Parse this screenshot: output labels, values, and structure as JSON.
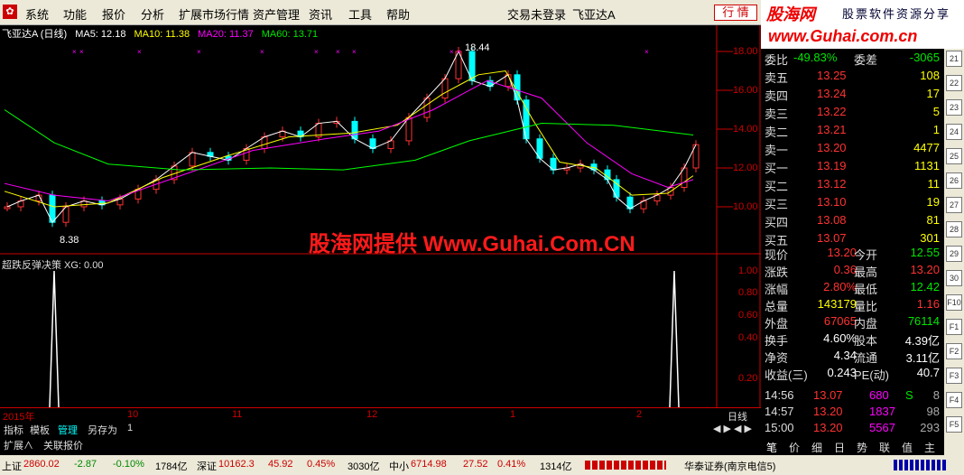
{
  "menu": {
    "items": [
      "系统",
      "功能",
      "报价",
      "分析",
      "扩展市场行情",
      "资产管理",
      "资讯",
      "工具",
      "帮助"
    ],
    "login_status": "交易未登录",
    "stock_title": "飞亚达A",
    "pill_label": "行 情"
  },
  "brand": {
    "name": "股海网",
    "slogan": "股票软件资源分享",
    "url": "www.Guhai.com.cn"
  },
  "legend": {
    "stock": "飞亚达A (日线)",
    "ma5": "MA5: 12.18",
    "ma10": "MA10: 11.38",
    "ma20": "MA20: 11.37",
    "ma60": "MA60: 13.71",
    "colors": {
      "ma5": "#ffffff",
      "ma10": "#ffff00",
      "ma20": "#ff00ff",
      "ma60": "#00ff00"
    }
  },
  "price_axis": [
    "18.00",
    "16.00",
    "14.00",
    "12.00",
    "10.00"
  ],
  "annotations": {
    "high": "18.44",
    "low": "8.38"
  },
  "watermark": "股海网提供 Www.Guhai.Com.CN",
  "indicator": {
    "title": "超跌反弹决策  XG: 0.00",
    "axis": [
      "1.00",
      "0.80",
      "0.60",
      "0.40",
      "0.20"
    ]
  },
  "date_axis": {
    "labels": [
      "2015年",
      "10",
      "11",
      "12",
      "1",
      "2"
    ],
    "period": "日线"
  },
  "tabs": [
    "指标",
    "模板",
    "管理",
    "另存为",
    "1"
  ],
  "tabs2": [
    "扩展∧",
    "关联报价"
  ],
  "quote": {
    "weibi": {
      "label": "委比",
      "value": "-49.83%",
      "label2": "委差",
      "value2": "-3065"
    },
    "asks": [
      {
        "label": "卖五",
        "price": "13.25",
        "vol": "108"
      },
      {
        "label": "卖四",
        "price": "13.24",
        "vol": "17"
      },
      {
        "label": "卖三",
        "price": "13.22",
        "vol": "5"
      },
      {
        "label": "卖二",
        "price": "13.21",
        "vol": "1"
      },
      {
        "label": "卖一",
        "price": "13.20",
        "vol": "4477"
      }
    ],
    "bids": [
      {
        "label": "买一",
        "price": "13.19",
        "vol": "1131"
      },
      {
        "label": "买二",
        "price": "13.12",
        "vol": "11"
      },
      {
        "label": "买三",
        "price": "13.10",
        "vol": "19"
      },
      {
        "label": "买四",
        "price": "13.08",
        "vol": "81"
      },
      {
        "label": "买五",
        "price": "13.07",
        "vol": "301"
      }
    ],
    "stats": [
      {
        "l1": "现价",
        "v1": "13.20",
        "l2": "今开",
        "v2": "12.55"
      },
      {
        "l1": "涨跌",
        "v1": "0.36",
        "l2": "最高",
        "v2": "13.20"
      },
      {
        "l1": "涨幅",
        "v1": "2.80%",
        "l2": "最低",
        "v2": "12.42"
      },
      {
        "l1": "总量",
        "v1": "143179",
        "l2": "量比",
        "v2": "1.16"
      },
      {
        "l1": "外盘",
        "v1": "67065",
        "l2": "内盘",
        "v2": "76114"
      },
      {
        "l1": "换手",
        "v1": "4.60%",
        "l2": "股本",
        "v2": "4.39亿"
      },
      {
        "l1": "净资",
        "v1": "4.34",
        "l2": "流通",
        "v2": "3.11亿"
      },
      {
        "l1": "收益(三)",
        "v1": "0.243",
        "l2": "PE(动)",
        "v2": "40.7"
      }
    ],
    "ticks": [
      {
        "time": "14:56",
        "price": "13.07",
        "vol": "680",
        "flag": "S",
        "n": "8"
      },
      {
        "time": "14:57",
        "price": "13.20",
        "vol": "1837",
        "flag": "",
        "n": "98"
      },
      {
        "time": "15:00",
        "price": "13.20",
        "vol": "5567",
        "flag": "",
        "n": "293"
      }
    ],
    "bottom_tabs": [
      "笔",
      "价",
      "细",
      "日",
      "势",
      "联",
      "值",
      "主"
    ]
  },
  "side_buttons": [
    "21",
    "22",
    "23",
    "24",
    "25",
    "26",
    "27",
    "28",
    "29",
    "30",
    "F10",
    "F1",
    "F2",
    "F3",
    "F4",
    "F5"
  ],
  "status": {
    "sh_label": "上证",
    "sh_value": "2860.02",
    "sh_chg": "-2.87",
    "sh_pct": "-0.10%",
    "sh_amt": "1784亿",
    "sz_label": "深证",
    "sz_value": "10162.3",
    "sz_chg": "45.92",
    "sz_pct": "0.45%",
    "sz_amt": "3030亿",
    "zx_label": "中小",
    "zx_value": "6714.98",
    "zx_chg": "27.52",
    "zx_pct": "0.41%",
    "zx_amt": "1314亿",
    "broker": "华泰证券(南京电信5)"
  }
}
